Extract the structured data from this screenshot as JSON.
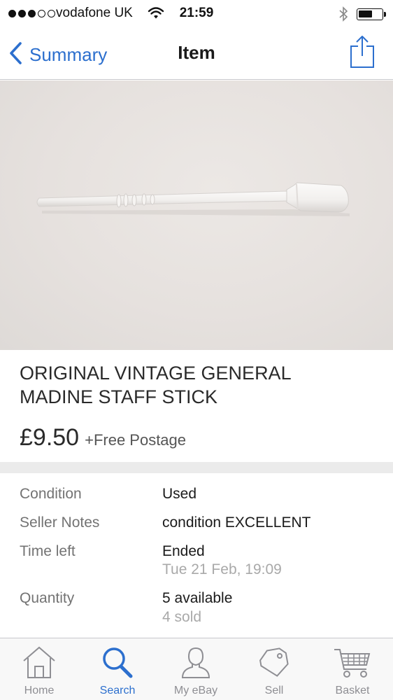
{
  "status_bar": {
    "carrier": "vodafone UK",
    "time": "21:59",
    "signal_strength": 3,
    "signal_max": 5,
    "battery_level": 0.6
  },
  "nav": {
    "back_label": "Summary",
    "title": "Item"
  },
  "listing": {
    "title": "ORIGINAL VINTAGE GENERAL MADINE STAFF STICK",
    "price": "£9.50",
    "postage": "+Free Postage"
  },
  "details": {
    "condition_label": "Condition",
    "condition_value": "Used",
    "seller_notes_label": "Seller Notes",
    "seller_notes_value": "condition EXCELLENT",
    "time_left_label": "Time left",
    "time_left_value": "Ended",
    "time_left_date": "Tue 21 Feb, 19:09",
    "quantity_label": "Quantity",
    "quantity_value": "5 available",
    "quantity_sold": "4 sold"
  },
  "tabs": [
    {
      "label": "Home",
      "icon": "home-icon",
      "active": false
    },
    {
      "label": "Search",
      "icon": "search-icon",
      "active": true
    },
    {
      "label": "My eBay",
      "icon": "person-icon",
      "active": false
    },
    {
      "label": "Sell",
      "icon": "tag-icon",
      "active": false
    },
    {
      "label": "Basket",
      "icon": "basket-icon",
      "active": false
    }
  ],
  "colors": {
    "accent": "#2c6fce",
    "inactive_tab": "#8e8e93",
    "label_gray": "#737373",
    "sub_gray": "#a9a9a9",
    "photo_background": "#e8e3e0"
  }
}
